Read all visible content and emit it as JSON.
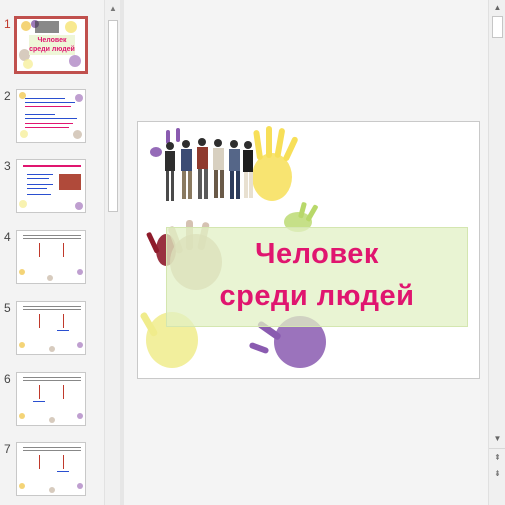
{
  "slides": [
    {
      "number": "1",
      "title_line1": "Человек",
      "title_line2": "среди людей"
    },
    {
      "number": "2"
    },
    {
      "number": "3",
      "heading": "Оно (какая-то подпись)"
    },
    {
      "number": "4"
    },
    {
      "number": "5"
    },
    {
      "number": "6"
    },
    {
      "number": "7"
    }
  ],
  "selected_slide": "1",
  "main_slide": {
    "title_line1": "Человек",
    "title_line2": "среди людей"
  },
  "colors": {
    "title": "#e0156f",
    "selection_border": "#c0504d",
    "title_box": "#e2f0c4"
  },
  "icons": {
    "scroll_up": "▲",
    "scroll_down": "▼",
    "prev_slide": "⇞",
    "next_slide": "⇟"
  }
}
